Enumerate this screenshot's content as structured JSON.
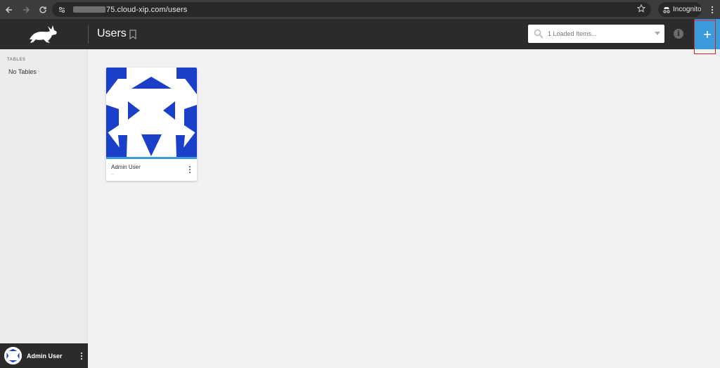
{
  "browser": {
    "url": "75.cloud-xip.com/users",
    "incognito_label": "Incognito"
  },
  "header": {
    "title": "Users",
    "search_placeholder": "1 Loaded Items..."
  },
  "sidebar": {
    "heading": "TABLES",
    "empty_text": "No Tables",
    "footer_user": "Admin User"
  },
  "users": [
    {
      "name": "Admin User",
      "subtitle": "--"
    }
  ],
  "colors": {
    "accent": "#3b9ad9",
    "header_bg": "#2b2b2b",
    "avatar_blue": "#1b3fc9",
    "highlight": "#d8232a"
  },
  "icons": {
    "back": "back-arrow-icon",
    "forward": "forward-arrow-icon",
    "reload": "reload-icon",
    "star": "star-icon",
    "bookmark": "bookmark-icon",
    "search": "search-icon",
    "info": "info-icon",
    "add": "plus-icon",
    "logo": "rabbit-logo-icon",
    "menu": "kebab-menu-icon"
  }
}
